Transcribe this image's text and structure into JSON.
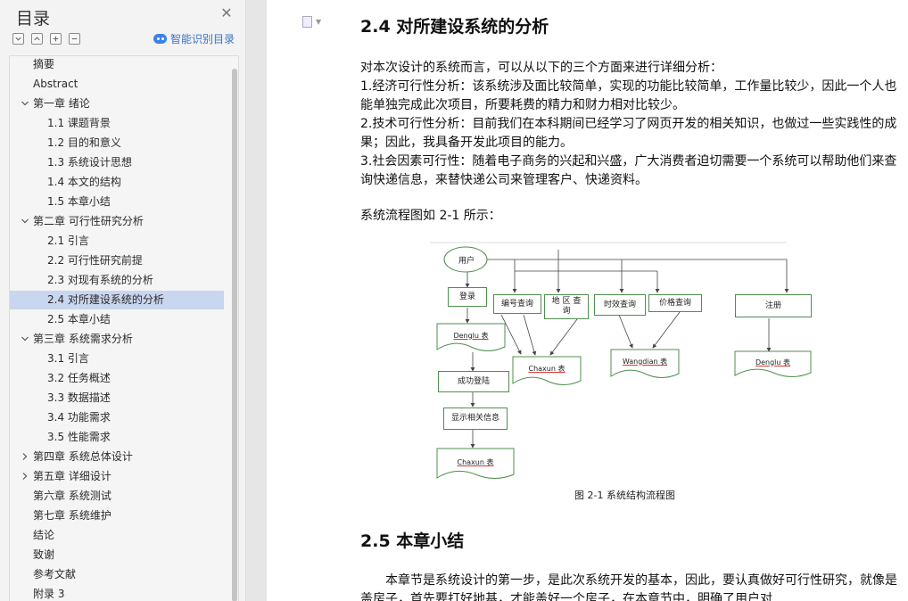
{
  "sidebar": {
    "title": "目录",
    "smart_toc_label": "智能识别目录",
    "toc": [
      {
        "label": "摘要",
        "level": 0,
        "arrow": "none"
      },
      {
        "label": "Abstract",
        "level": 0,
        "arrow": "none"
      },
      {
        "label": "第一章   绪论",
        "level": 0,
        "arrow": "down"
      },
      {
        "label": "1.1 课题背景",
        "level": 1,
        "arrow": "none"
      },
      {
        "label": "1.2 目的和意义",
        "level": 1,
        "arrow": "none"
      },
      {
        "label": "1.3 系统设计思想",
        "level": 1,
        "arrow": "none"
      },
      {
        "label": "1.4 本文的结构",
        "level": 1,
        "arrow": "none"
      },
      {
        "label": "1.5 本章小结",
        "level": 1,
        "arrow": "none"
      },
      {
        "label": "第二章  可行性研究分析",
        "level": 0,
        "arrow": "down"
      },
      {
        "label": "2.1 引言",
        "level": 1,
        "arrow": "none"
      },
      {
        "label": "2.2 可行性研究前提",
        "level": 1,
        "arrow": "none"
      },
      {
        "label": "2.3 对现有系统的分析",
        "level": 1,
        "arrow": "none"
      },
      {
        "label": "2.4 对所建设系统的分析",
        "level": 1,
        "arrow": "none",
        "active": true
      },
      {
        "label": "2.5 本章小结",
        "level": 1,
        "arrow": "none"
      },
      {
        "label": "第三章    系统需求分析",
        "level": 0,
        "arrow": "down"
      },
      {
        "label": "3.1 引言",
        "level": 1,
        "arrow": "none"
      },
      {
        "label": "3.2 任务概述",
        "level": 1,
        "arrow": "none"
      },
      {
        "label": "3.3 数据描述",
        "level": 1,
        "arrow": "none"
      },
      {
        "label": "3.4 功能需求",
        "level": 1,
        "arrow": "none"
      },
      {
        "label": "3.5 性能需求",
        "level": 1,
        "arrow": "none"
      },
      {
        "label": "第四章  系统总体设计",
        "level": 0,
        "arrow": "right"
      },
      {
        "label": "第五章    详细设计",
        "level": 0,
        "arrow": "right"
      },
      {
        "label": "第六章  系统测试",
        "level": 0,
        "arrow": "none"
      },
      {
        "label": "第七章  系统维护",
        "level": 0,
        "arrow": "none"
      },
      {
        "label": "结论",
        "level": 0,
        "arrow": "none"
      },
      {
        "label": "致谢",
        "level": 0,
        "arrow": "none"
      },
      {
        "label": "参考文献",
        "level": 0,
        "arrow": "none"
      },
      {
        "label": "附录 3",
        "level": 0,
        "arrow": "none"
      }
    ]
  },
  "doc": {
    "heading_24": "2.4 对所建设系统的分析",
    "intro": "对本次设计的系统而言，可以从以下的三个方面来进行详细分析：",
    "point1": "1.经济可行性分析：该系统涉及面比较简单，实现的功能比较简单，工作量比较少，因此一个人也能单独完成此次项目，所要耗费的精力和财力相对比较少。",
    "point2": "2.技术可行性分析：目前我们在本科期间已经学习了网页开发的相关知识，也做过一些实践性的成果；因此，我具备开发此项目的能力。",
    "point3": "3.社会因素可行性：随着电子商务的兴起和兴盛，广大消费者迫切需要一个系统可以帮助他们来查询快递信息，来替快递公司来管理客户、快递资料。",
    "flow_ref": "系统流程图如 2-1 所示：",
    "caption": "图 2-1  系统结构流程图",
    "heading_25": "2.5 本章小结",
    "summary": "本章节是系统设计的第一步，是此次系统开发的基本，因此，要认真做好可行性研究，就像是盖房子，首先要打好地基，才能盖好一个房子，在本章节中，明确了用户对"
  },
  "diagram": {
    "user": "用户",
    "login": "登录",
    "q_number": "编号查询",
    "q_area": "地 区 查 询",
    "q_time": "时效查询",
    "q_price": "价格查询",
    "register": "注册",
    "t_denglu": "Denglu 表",
    "t_chaxun": "Chaxun 表",
    "t_wangdian": "Wangdian 表",
    "t_denglu2": "Denglu 表",
    "login_ok": "成功登陆",
    "show_info": "显示相关信息",
    "t_chaxun2": "Chaxun 表"
  }
}
